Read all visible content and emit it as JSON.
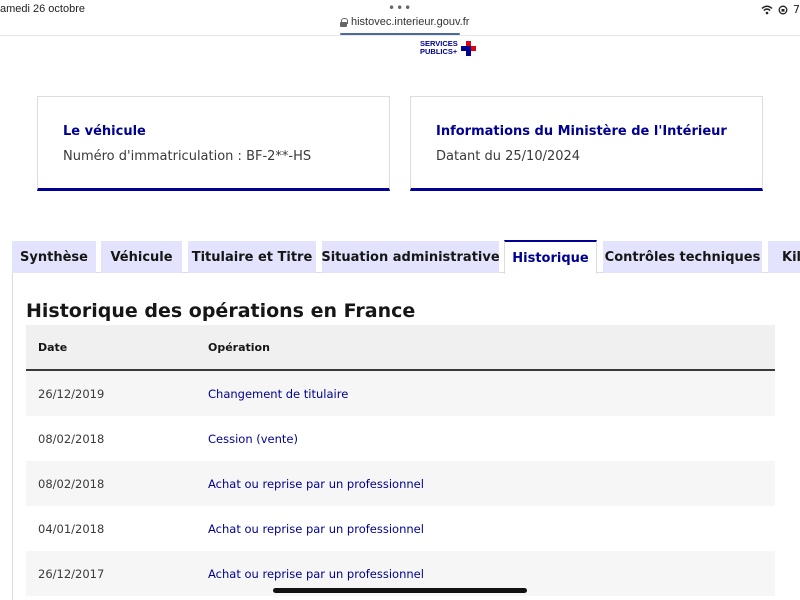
{
  "statusbar": {
    "date": "amedi 26 octobre",
    "url": "histovec.interieur.gouv.fr",
    "dots": "•••",
    "battery_partial": "7"
  },
  "logo": {
    "line1": "SERVICES",
    "line2": "PUBLICS+"
  },
  "vehicle_card": {
    "title": "Le véhicule",
    "text": "Numéro d'immatriculation : BF-2**-HS"
  },
  "ministry_card": {
    "title": "Informations du Ministère de l'Intérieur",
    "text": "Datant du 25/10/2024"
  },
  "tabs": [
    {
      "label": "Synthèse"
    },
    {
      "label": "Véhicule"
    },
    {
      "label": "Titulaire et Titre"
    },
    {
      "label": "Situation administrative"
    },
    {
      "label": "Historique"
    },
    {
      "label": "Contrôles techniques"
    },
    {
      "label": "Kilo"
    }
  ],
  "history": {
    "title": "Historique des opérations en France",
    "columns": {
      "date": "Date",
      "operation": "Opération"
    },
    "rows": [
      {
        "date": "26/12/2019",
        "operation": "Changement de titulaire"
      },
      {
        "date": "08/02/2018",
        "operation": "Cession (vente)"
      },
      {
        "date": "08/02/2018",
        "operation": "Achat ou reprise par un professionnel"
      },
      {
        "date": "04/01/2018",
        "operation": "Achat ou reprise par un professionnel"
      },
      {
        "date": "26/12/2017",
        "operation": "Achat ou reprise par un professionnel"
      }
    ]
  },
  "colors": {
    "brand_blue": "#000091",
    "tab_bg": "#e3e3fd",
    "marianne_red": "#e1000f"
  }
}
